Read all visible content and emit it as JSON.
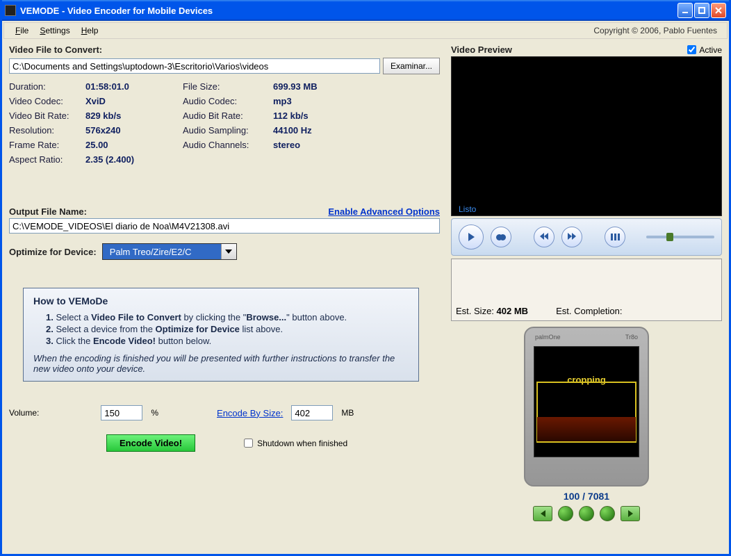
{
  "window": {
    "title": "VEMODE - Video Encoder for Mobile Devices"
  },
  "menubar": {
    "file": "File",
    "settings": "Settings",
    "help": "Help",
    "copyright": "Copyright © 2006, Pablo Fuentes"
  },
  "input": {
    "section_label": "Video File to Convert:",
    "path": "C:\\Documents and Settings\\uptodown-3\\Escritorio\\Varios\\videos",
    "browse_btn": "Examinar..."
  },
  "info": {
    "duration_label": "Duration:",
    "duration": "01:58:01.0",
    "vcodec_label": "Video Codec:",
    "vcodec": "XviD",
    "vbitrate_label": "Video Bit Rate:",
    "vbitrate": "829 kb/s",
    "res_label": "Resolution:",
    "res": "576x240",
    "fps_label": "Frame Rate:",
    "fps": "25.00",
    "ar_label": "Aspect Ratio:",
    "ar": "2.35 (2.400)",
    "fsize_label": "File Size:",
    "fsize": "699.93 MB",
    "acodec_label": "Audio Codec:",
    "acodec": "mp3",
    "abitrate_label": "Audio Bit Rate:",
    "abitrate": "112 kb/s",
    "asamp_label": "Audio Sampling:",
    "asamp": "44100 Hz",
    "ach_label": "Audio Channels:",
    "ach": "stereo"
  },
  "output": {
    "label": "Output File Name:",
    "advanced_link": "Enable Advanced Options",
    "path": "C:\\VEMODE_VIDEOS\\El diario de Noa\\M4V21308.avi"
  },
  "optimize": {
    "label": "Optimize for Device:",
    "selected": "Palm Treo/Zire/E2/C"
  },
  "howto": {
    "title": "How to VEMoDe",
    "step1_pre": "Select a ",
    "step1_b": "Video File to Convert",
    "step1_mid": " by clicking the \"",
    "step1_b2": "Browse...",
    "step1_post": "\" button above.",
    "step2_pre": "Select a device from the ",
    "step2_b": "Optimize for Device",
    "step2_post": " list above.",
    "step3_pre": "Click the ",
    "step3_b": "Encode Video!",
    "step3_post": " button below.",
    "note": "When the encoding is finished you will be presented with further instructions to transfer the new video onto your device."
  },
  "bottom": {
    "volume_label": "Volume:",
    "volume_value": "150",
    "volume_unit": "%",
    "encode_by_size_label": "Encode By Size:",
    "encode_by_size_value": "402",
    "encode_by_size_unit": "MB",
    "encode_btn": "Encode Video!",
    "shutdown_label": "Shutdown when finished"
  },
  "preview": {
    "label": "Video Preview",
    "active_label": "Active",
    "status": "Listo"
  },
  "est": {
    "size_label": "Est. Size:",
    "size_value": "402 MB",
    "completion_label": "Est. Completion:"
  },
  "device": {
    "brand": "palmOne",
    "model": "Tr8o",
    "crop_text": "cropping",
    "progress": "100 / 7081"
  }
}
